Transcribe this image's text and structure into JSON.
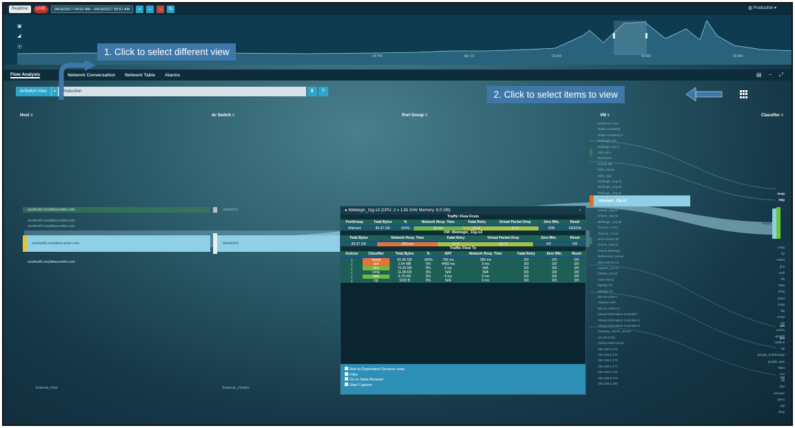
{
  "topbar": {
    "realtime": "Realtime",
    "live": "LIVE",
    "daterange": "04/16/2017 04:52 AM - 04/16/2017 09:51 AM",
    "production": "Production"
  },
  "timeline": {
    "labels": [
      "08 PM",
      "Apr 16",
      "03 AM",
      "06 AM",
      "09 AM"
    ]
  },
  "tabs": [
    "Flow Analysis",
    "Network Conversation",
    "Network Table",
    "Alarms"
  ],
  "view": {
    "mode": "dvSwitch View",
    "filter": "Production"
  },
  "callouts": {
    "one": "1. Click to select different view",
    "two": "2. Click to select items to view"
  },
  "columns": {
    "host": "Host ≡",
    "switch": "dv Switch ≡",
    "portgroup": "Port Group ≡",
    "vm": "VM ≡",
    "classifier": "Classifier ≡"
  },
  "hosts": {
    "h1": "esxihost3.vreyfabsecenter.com",
    "h2": "esxihost3.vreyfabsecenter.com",
    "h3": "esxihost4.vreyfabsecenter.com",
    "h4": "esxihost5.vreyfabsecenter.com",
    "h5": "esxihost6.vreyfabsecenter.com",
    "external": "External_Host"
  },
  "switches": {
    "s1": "dvSwitch1",
    "s2": "dvSwitch2",
    "external": "External_vSwitch"
  },
  "vm_highlight": "Weblogic_11g-s2",
  "classifier_highlight": {
    "a": "icmp",
    "b": "http",
    "c": "mysql",
    "d": "ssh",
    "e": "dns",
    "f": "lcp"
  },
  "popup": {
    "title": "Weblogic_11g-s2 (CPU: 2 x 1.81 GHz Memory: 8.0 GB)",
    "from_title": "Traffic Flow From",
    "from_headers": [
      "PortGroup",
      "Total Bytes",
      "%",
      "Network Resp. Time",
      "Fatal Retry",
      "Virtual Packet Drop",
      "Zero Win.",
      "Reset"
    ],
    "from_row": [
      "Walmart",
      "82.97 GB",
      "100%",
      "22 ms",
      "2 / 2",
      "2 / 2",
      "0/95",
      "150/239"
    ],
    "vm_title": "VM: Weblogic_11g-s2",
    "vm_headers": [
      "Total Bytes",
      "Network Resp. Time",
      "Fatal Retry",
      "Virtual Packet Drop",
      "Zero Win.",
      "Reset"
    ],
    "vm_row": [
      "82.97 GB",
      "203 ms",
      "2 / 2",
      "22 / 2",
      "0/0",
      "0/0"
    ],
    "to_title": "Traffic Flow To",
    "to_headers": [
      "Actions",
      "Classifier",
      "Total Bytes",
      "%",
      "ART",
      "Network Resp. Time",
      "Fatal Retry",
      "Zero Win.",
      "Reset"
    ],
    "to_rows": [
      [
        "⤓",
        "mysql",
        "82.96 GB",
        "100%",
        "756 ms",
        "300 ms",
        "0/0",
        "0/0",
        "0/0"
      ],
      [
        "⤓",
        "ssh",
        "1.54 MB",
        "0%",
        "4456 ms",
        "0 ms",
        "0/0",
        "0/0",
        "0/0"
      ],
      [
        "⤓",
        "dns",
        "74.26 KB",
        "0%",
        "0 ms",
        "N/A",
        "0/0",
        "0/0",
        "0/0"
      ],
      [
        "⤓",
        "icmp",
        "11.48 KB",
        "0%",
        "N/A",
        "N/A",
        "0/0",
        "0/0",
        "0/0"
      ],
      [
        "⤓",
        "http",
        "6.75 KB",
        "0%",
        "4 ms",
        "0 ms",
        "0/0",
        "0/0",
        "0/0"
      ],
      [
        "⤓",
        "lcp",
        "1020 B",
        "0%",
        "N/A",
        "0 ms",
        "0/0",
        "0/0",
        "0/0"
      ]
    ],
    "actions": [
      "Add to Dependent Services view",
      "Filter",
      "Go to Stats Browser",
      "Start Capture"
    ]
  },
  "vm_list": [
    "Reference VM",
    "Redis-ActiveMQ",
    "Redis-ActiveMQ-2",
    "Weblogic-12c",
    "Weblogic-12c-2",
    "VM-Linux",
    "Dynatrace",
    "Oracle-DB",
    "EBS_Server",
    "EBS_App",
    "Weblogic_11g-s1",
    "Weblogic_11g-s3",
    "Weblogic_11g-s4",
    "JBoss_Server",
    "Tomcat_7.0",
    "Oracle_11g-s1",
    "Oracle_11g-s2",
    "Weblogic_11g-s5",
    "Tomcat_7.0-s1",
    "Tomcat_7.0-s2",
    "DNS-Server-01",
    "Oracle_11g-s3",
    "Oracle-Weblogic",
    "Websocket_Server",
    "Web-Server-01",
    "Apache_2.4-s1",
    "Zimbra_8.6-s1",
    "VSS-VM-01",
    "MySQL-01",
    "MSSQL-01",
    "WS-01-OOFY",
    "VMware-vMA",
    "WS-01-OOFY-2",
    "Virtual Information Controller",
    "Virtual Information Controller-2",
    "Virtual Information Controller-3",
    "Gateway_SMTP_Server",
    "10.100.0.211",
    "Zimbra Mail Server",
    "192.168.0.174",
    "192.168.0.175",
    "192.168.0.176",
    "192.168.0.177",
    "192.168.0.178",
    "192.168.0.179",
    "192.168.0.180"
  ],
  "classifier_list": [
    "soap",
    "ftp",
    "telnet",
    "dns",
    "smb",
    "nfs",
    "ldap",
    "smtp",
    "pop3",
    "imap",
    "rdp",
    "snmp",
    "ntp",
    "oracle",
    "google",
    "netbios",
    "sip",
    "google_bulkstorage",
    "google_apis",
    "https",
    "vnc",
    "rtp",
    "rtcp",
    "vmware",
    "ipsec",
    "arp",
    "drop"
  ]
}
